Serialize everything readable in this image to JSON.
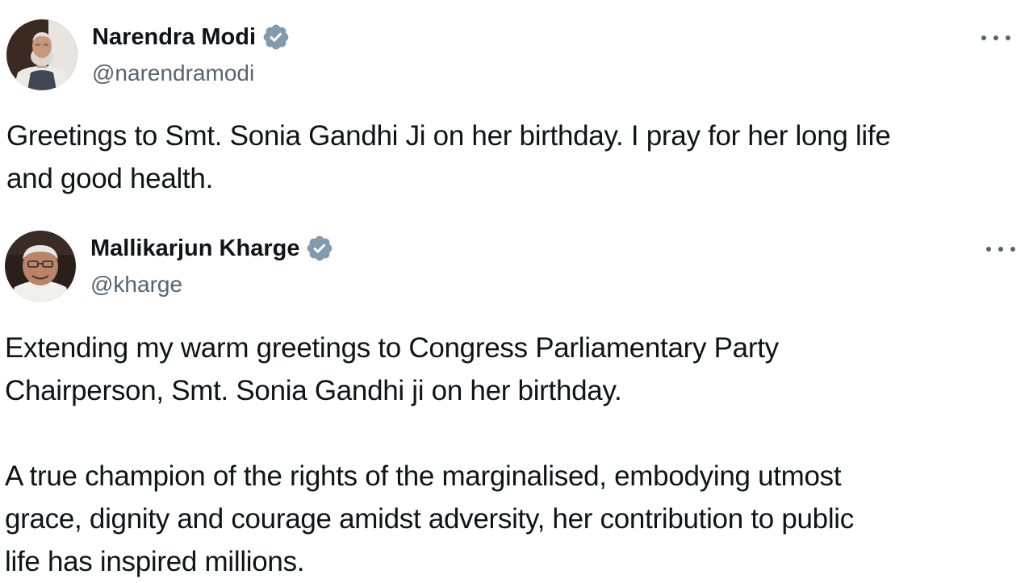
{
  "tweets": [
    {
      "author_name": "Narendra Modi",
      "handle": "@narendramodi",
      "verified_icon": "verified-badge-icon",
      "more_icon": "more-options-icon",
      "text": "Greetings to Smt. Sonia Gandhi Ji on her birthday. I pray for her long life\nand good health."
    },
    {
      "author_name": "Mallikarjun Kharge",
      "handle": "@kharge",
      "verified_icon": "verified-badge-icon",
      "more_icon": "more-options-icon",
      "text": "Extending my warm greetings to Congress Parliamentary Party\nChairperson, Smt. Sonia Gandhi ji on her birthday.\n\nA true champion of the rights of the marginalised, embodying utmost\ngrace, dignity and courage amidst adversity, her contribution to public\nlife has inspired millions."
    }
  ],
  "colors": {
    "text_primary": "#0f1419",
    "text_secondary": "#536471",
    "verified_badge": "#829aab",
    "background": "#ffffff"
  }
}
